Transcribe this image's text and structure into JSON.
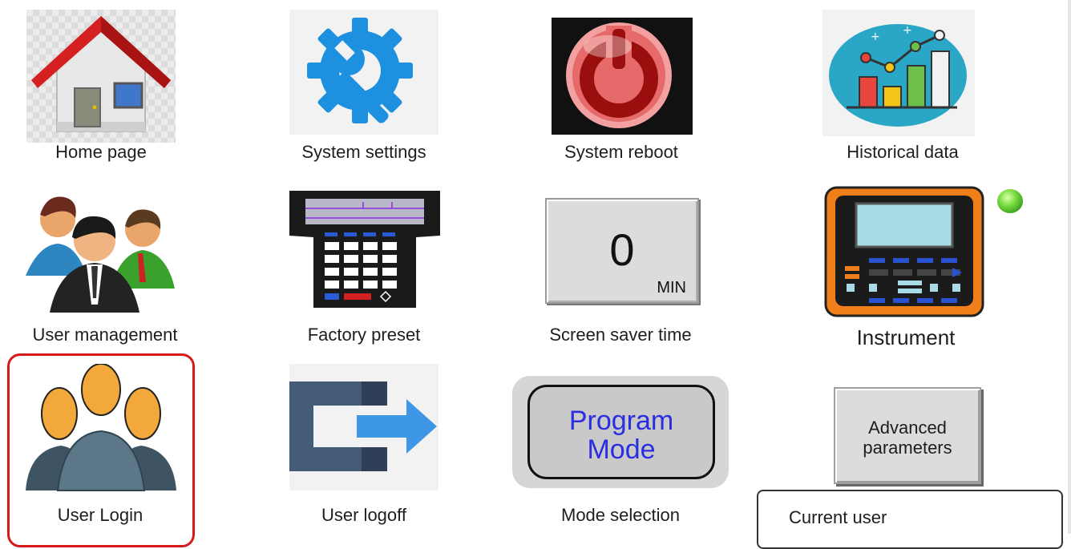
{
  "tiles": {
    "home": {
      "label": "Home page"
    },
    "system_settings": {
      "label": "System settings"
    },
    "system_reboot": {
      "label": "System reboot"
    },
    "historical_data": {
      "label": "Historical data"
    },
    "user_management": {
      "label": "User management"
    },
    "factory_preset": {
      "label": "Factory preset"
    },
    "screen_saver": {
      "label": "Screen saver time",
      "value": "0",
      "unit": "MIN"
    },
    "instrument": {
      "label": "Instrument"
    },
    "user_login": {
      "label": "User Login"
    },
    "user_logoff": {
      "label": "User logoff"
    },
    "mode_selection": {
      "label": "Mode selection",
      "button_line1": "Program",
      "button_line2": "Mode"
    },
    "advanced": {
      "line1": "Advanced",
      "line2": "parameters"
    }
  },
  "current_user": {
    "label": "Current user"
  },
  "colors": {
    "selection_border": "#d71a1a",
    "mode_text": "#2a2ee0",
    "status_led": "#6ee03a",
    "settings_gear": "#1e90e0"
  },
  "icons": [
    "house-icon",
    "gear-wrench-icon",
    "power-icon",
    "bar-chart-icon",
    "users-icon",
    "handheld-terminal-icon",
    "instrument-icon",
    "user-group-icon",
    "logout-arrow-icon"
  ],
  "status": {
    "instrument_led": "on"
  }
}
